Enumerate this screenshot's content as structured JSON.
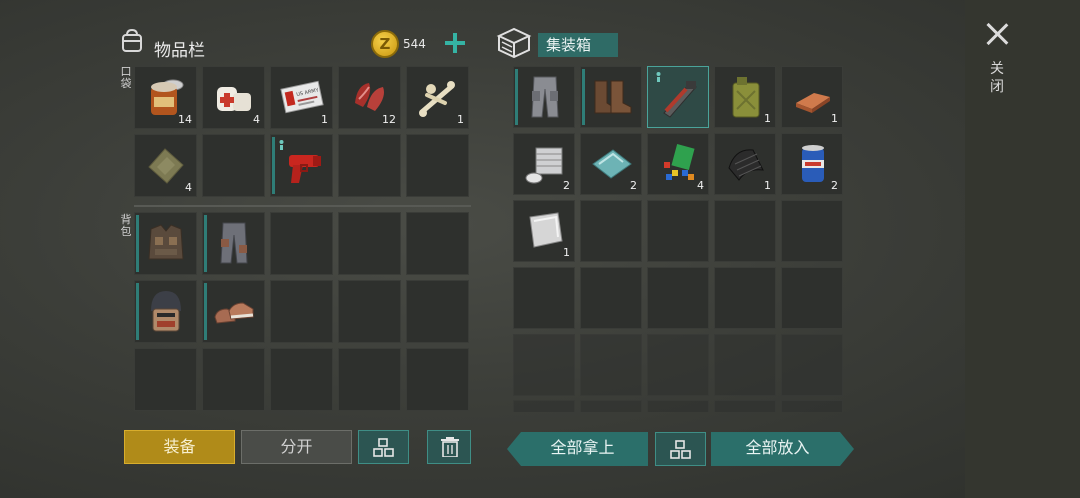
{
  "close": {
    "label": "关闭"
  },
  "inventory": {
    "title": "物品栏",
    "coins": "544",
    "coin_symbol": "Z",
    "pockets_label": "口袋",
    "backpack_label": "背包",
    "pocket_slots": [
      {
        "item": "canned-food",
        "count": "14"
      },
      {
        "item": "bandage",
        "count": "4"
      },
      {
        "item": "army-id-card",
        "count": "1",
        "card_text": "US ARMY"
      },
      {
        "item": "raw-meat",
        "count": "12"
      },
      {
        "item": "bones",
        "count": "1"
      },
      {
        "item": "cloth",
        "count": "4"
      },
      {
        "item": "",
        "count": ""
      },
      {
        "item": "flare-gun",
        "count": ""
      },
      {
        "item": "",
        "count": ""
      },
      {
        "item": "",
        "count": ""
      }
    ],
    "backpack_slots": [
      {
        "item": "tactical-vest",
        "count": ""
      },
      {
        "item": "tactical-pants",
        "count": ""
      },
      {
        "item": "",
        "count": ""
      },
      {
        "item": "",
        "count": ""
      },
      {
        "item": "",
        "count": ""
      },
      {
        "item": "armored-helmet",
        "count": ""
      },
      {
        "item": "sneakers",
        "count": ""
      },
      {
        "item": "",
        "count": ""
      },
      {
        "item": "",
        "count": ""
      },
      {
        "item": "",
        "count": ""
      },
      {
        "item": "",
        "count": ""
      },
      {
        "item": "",
        "count": ""
      },
      {
        "item": "",
        "count": ""
      },
      {
        "item": "",
        "count": ""
      },
      {
        "item": "",
        "count": ""
      }
    ]
  },
  "container": {
    "title": "集装箱",
    "slots": [
      {
        "item": "cargo-pants",
        "count": ""
      },
      {
        "item": "leather-boots",
        "count": ""
      },
      {
        "item": "chainsaw-blade",
        "count": ""
      },
      {
        "item": "jerry-can",
        "count": "1"
      },
      {
        "item": "copper-ingot",
        "count": "1"
      },
      {
        "item": "engine-cylinder",
        "count": "2"
      },
      {
        "item": "glass-sheet",
        "count": "2"
      },
      {
        "item": "electronic-parts",
        "count": "4"
      },
      {
        "item": "rubber-sheet",
        "count": "1"
      },
      {
        "item": "beer-can",
        "count": "2"
      },
      {
        "item": "metal-plate",
        "count": "1"
      }
    ]
  },
  "buttons": {
    "equip": "装备",
    "split": "分开",
    "take_all": "全部拿上",
    "put_all": "全部放入"
  },
  "colors": {
    "accent": "#35b3a4",
    "equip": "#b08b19",
    "teal_button": "#2b6f6a"
  }
}
